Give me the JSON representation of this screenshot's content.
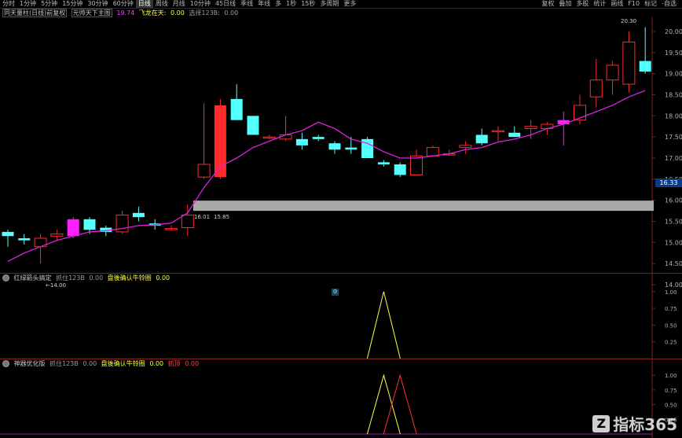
{
  "toolbar": {
    "left_items": [
      "分时",
      "1分钟",
      "5分钟",
      "15分钟",
      "30分钟",
      "60分钟",
      "日线",
      "周线",
      "月线",
      "10分钟",
      "45日线",
      "季线",
      "年线",
      "多",
      "1秒",
      "15秒",
      "多周期",
      "更多"
    ],
    "active_index": 6,
    "right_items": [
      "复权",
      "叠加",
      "多股",
      "统计",
      "画线",
      "F10",
      "标记",
      "-自选"
    ]
  },
  "info": {
    "title": "同天量柱(日线)前复权",
    "indicator_name": "元帅天下主图",
    "value1": "19.74",
    "label2": "飞龙在天:",
    "value2": "0.00",
    "label3": "选择123B:",
    "value3": "0.00"
  },
  "price_axis": {
    "ticks": [
      "20.00",
      "19.50",
      "19.00",
      "18.50",
      "18.00",
      "17.50",
      "17.00",
      "16.50",
      "16.00",
      "15.50",
      "15.00",
      "14.50",
      "14.00"
    ],
    "current_label": "16.33",
    "top_label": "20.30",
    "low_label": "14.00",
    "band_label_left": "16.01",
    "band_label_right": "15.85"
  },
  "panel2": {
    "name": "红绿箭头搞定",
    "label1": "抓住123B",
    "value1": "0.00",
    "label2": "盘後确认牛铃圈",
    "value2": "0.00",
    "axis": [
      "1.00",
      "0.75",
      "0.50",
      "0.25"
    ]
  },
  "panel3": {
    "name": "神器优化版",
    "label1": "抓住123B",
    "value1": "0.00",
    "label2": "盘後确认牛铃圈",
    "value2": "0.00",
    "label3": "抓顶",
    "value3": "0.00",
    "axis": [
      "1.00",
      "0.75",
      "0.50",
      "0.25"
    ]
  },
  "watermark": {
    "text": "指标365",
    "icon": "Z"
  },
  "colors": {
    "up": "#ff2a2a",
    "down": "#54ffff",
    "ma": "#e020e0",
    "band": "#a9a9a9",
    "magenta": "#ff20ff",
    "yellow": "#ffff40"
  },
  "chart_data": {
    "type": "candlestick",
    "candles": [
      {
        "o": 15.25,
        "c": 15.15,
        "h": 15.3,
        "l": 14.9
      },
      {
        "o": 15.1,
        "c": 15.05,
        "h": 15.2,
        "l": 14.95
      },
      {
        "o": 14.9,
        "c": 15.1,
        "h": 15.2,
        "l": 14.5
      },
      {
        "o": 15.15,
        "c": 15.2,
        "h": 15.3,
        "l": 15.05
      },
      {
        "o": 15.15,
        "c": 15.55,
        "h": 15.6,
        "l": 15.1
      },
      {
        "o": 15.55,
        "c": 15.3,
        "h": 15.6,
        "l": 15.2
      },
      {
        "o": 15.35,
        "c": 15.25,
        "h": 15.4,
        "l": 15.15
      },
      {
        "o": 15.25,
        "c": 15.65,
        "h": 15.75,
        "l": 15.2
      },
      {
        "o": 15.7,
        "c": 15.6,
        "h": 15.85,
        "l": 15.5
      },
      {
        "o": 15.45,
        "c": 15.4,
        "h": 15.55,
        "l": 15.3
      },
      {
        "o": 15.33,
        "c": 15.33,
        "h": 15.4,
        "l": 15.28
      },
      {
        "o": 15.35,
        "c": 15.65,
        "h": 15.9,
        "l": 15.15
      },
      {
        "o": 16.55,
        "c": 16.85,
        "h": 18.3,
        "l": 16.5
      },
      {
        "o": 16.55,
        "c": 18.25,
        "h": 18.4,
        "l": 16.5
      },
      {
        "o": 18.4,
        "c": 17.9,
        "h": 18.75,
        "l": 17.9
      },
      {
        "o": 18.0,
        "c": 17.55,
        "h": 17.8,
        "l": 17.55
      },
      {
        "o": 17.5,
        "c": 17.5,
        "h": 17.55,
        "l": 17.45
      },
      {
        "o": 17.45,
        "c": 17.55,
        "h": 18.0,
        "l": 17.4
      },
      {
        "o": 17.45,
        "c": 17.3,
        "h": 17.6,
        "l": 17.2
      },
      {
        "o": 17.5,
        "c": 17.45,
        "h": 17.55,
        "l": 17.4
      },
      {
        "o": 17.35,
        "c": 17.2,
        "h": 17.4,
        "l": 17.1
      },
      {
        "o": 17.25,
        "c": 17.2,
        "h": 17.5,
        "l": 17.1
      },
      {
        "o": 17.45,
        "c": 17.0,
        "h": 17.5,
        "l": 17.0
      },
      {
        "o": 16.9,
        "c": 16.85,
        "h": 16.95,
        "l": 16.8
      },
      {
        "o": 16.85,
        "c": 16.6,
        "h": 16.9,
        "l": 16.55
      },
      {
        "o": 16.6,
        "c": 17.05,
        "h": 17.2,
        "l": 16.6
      },
      {
        "o": 17.05,
        "c": 17.25,
        "h": 17.3,
        "l": 17.05
      },
      {
        "o": 17.1,
        "c": 17.1,
        "h": 17.2,
        "l": 17.05
      },
      {
        "o": 17.25,
        "c": 17.3,
        "h": 17.4,
        "l": 17.1
      },
      {
        "o": 17.55,
        "c": 17.35,
        "h": 17.7,
        "l": 17.3
      },
      {
        "o": 17.65,
        "c": 17.65,
        "h": 17.75,
        "l": 17.4
      },
      {
        "o": 17.6,
        "c": 17.5,
        "h": 17.75,
        "l": 17.5
      },
      {
        "o": 17.7,
        "c": 17.75,
        "h": 17.9,
        "l": 17.45
      },
      {
        "o": 17.7,
        "c": 17.8,
        "h": 17.85,
        "l": 17.55
      },
      {
        "o": 17.8,
        "c": 17.9,
        "h": 18.1,
        "l": 17.3
      },
      {
        "o": 17.9,
        "c": 18.25,
        "h": 18.5,
        "l": 17.8
      },
      {
        "o": 18.45,
        "c": 18.85,
        "h": 19.35,
        "l": 18.2
      },
      {
        "o": 18.85,
        "c": 19.2,
        "h": 19.3,
        "l": 18.5
      },
      {
        "o": 18.75,
        "c": 19.75,
        "h": 20.0,
        "l": 18.55
      },
      {
        "o": 19.3,
        "c": 19.05,
        "h": 20.1,
        "l": 19.0
      }
    ],
    "candle_flags": [
      0,
      0,
      0,
      0,
      1,
      0,
      0,
      0,
      0,
      0,
      0,
      0,
      0,
      2,
      0,
      0,
      0,
      0,
      0,
      0,
      0,
      0,
      0,
      0,
      0,
      0,
      0,
      0,
      0,
      0,
      0,
      0,
      0,
      0,
      1,
      0,
      0,
      0,
      0,
      0
    ],
    "ma": [
      14.55,
      14.75,
      14.9,
      15.05,
      15.15,
      15.25,
      15.28,
      15.33,
      15.4,
      15.42,
      15.46,
      15.7,
      16.3,
      16.8,
      17.0,
      17.25,
      17.4,
      17.55,
      17.65,
      17.85,
      17.7,
      17.45,
      17.35,
      17.15,
      17.0,
      17.0,
      17.05,
      17.1,
      17.2,
      17.25,
      17.38,
      17.45,
      17.55,
      17.7,
      17.8,
      17.95,
      18.1,
      18.25,
      18.45,
      18.6
    ],
    "band": {
      "low": 16.01,
      "high": 15.85
    },
    "panel2_peak_index": 23,
    "panel3_peaks": [
      {
        "index": 23,
        "series": "yellow"
      },
      {
        "index": 24,
        "series": "red"
      }
    ]
  }
}
